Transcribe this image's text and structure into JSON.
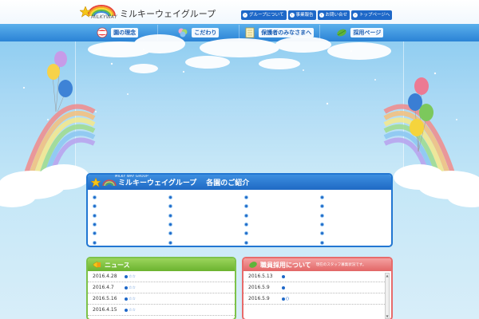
{
  "header": {
    "logo_en": "MILKYWAY",
    "logo_jp": "ミルキーウェイグループ",
    "topnav": [
      {
        "label": "グループについて",
        "icon": "chevron-right-icon"
      },
      {
        "label": "事業報告",
        "icon": "chevron-right-icon"
      },
      {
        "label": "お問い合せ",
        "icon": "chevron-right-icon"
      },
      {
        "label": "トップページへ",
        "icon": "chevron-right-icon"
      }
    ]
  },
  "mainnav": {
    "items": [
      {
        "label": "園の理念",
        "icon": "ball-icon"
      },
      {
        "label": "こだわり",
        "icon": "balloons-icon"
      },
      {
        "label": "保護者のみなさまへ",
        "icon": "notebook-icon"
      },
      {
        "label": "採用ページ",
        "icon": "leaf-icon"
      }
    ]
  },
  "group": {
    "logo_en": "MILKY WAY GROUP",
    "logo_jp": "ミルキーウェイグループ",
    "title": "各園のご紹介",
    "columns": [
      [
        "",
        "",
        "",
        "",
        "",
        ""
      ],
      [
        "",
        "",
        "",
        "",
        "",
        ""
      ],
      [
        "",
        "",
        "",
        "",
        "",
        ""
      ],
      [
        "",
        "",
        "",
        "",
        "",
        ""
      ]
    ]
  },
  "news": {
    "title": "ニュース",
    "rows": [
      {
        "date": "2016.4.28",
        "text": "☆☆"
      },
      {
        "date": "2016.4.7",
        "text": "☆☆"
      },
      {
        "date": "2016.5.16",
        "text": "☆☆"
      },
      {
        "date": "2016.4.15",
        "text": "☆☆"
      }
    ]
  },
  "recruit": {
    "title": "職員採用について",
    "subtitle": "現在のスタッフ募集状況です。",
    "rows": [
      {
        "date": "2016.5.13",
        "text": ""
      },
      {
        "date": "2016.5.9",
        "text": ""
      },
      {
        "date": "2016.5.9",
        "text": "()"
      }
    ]
  },
  "colors": {
    "primary_blue": "#1e68c8",
    "nav_blue": "#2b83d6",
    "news_green": "#7dc249",
    "recruit_red": "#e86b6b"
  }
}
